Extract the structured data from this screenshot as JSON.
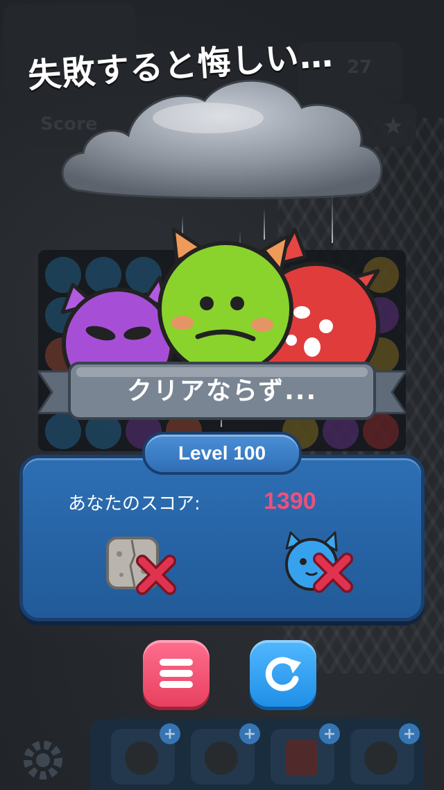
{
  "caption": "失敗すると悔しい…",
  "background": {
    "score_label": "Score",
    "moves": "27"
  },
  "banner": {
    "text": "クリアならず..."
  },
  "level": {
    "label": "Level 100"
  },
  "result": {
    "score_label": "あなたのスコア:",
    "score_value": "1390",
    "goals": [
      {
        "icon": "stone-block-icon",
        "status": "failed"
      },
      {
        "icon": "blue-cat-monster-icon",
        "status": "failed"
      }
    ]
  },
  "buttons": {
    "menu_icon": "menu-icon",
    "retry_icon": "retry-icon"
  },
  "boosters": [
    {
      "icon": "bomb-icon"
    },
    {
      "icon": "bomb-icon"
    },
    {
      "icon": "dynamite-icon"
    },
    {
      "icon": "bomb-icon"
    }
  ],
  "colors": {
    "score_value": "#f0507a",
    "panel": "#2d6fb4",
    "menu_button": "#ff6f8f",
    "retry_button": "#1f8fe6",
    "fail_x": "#e0334f"
  }
}
